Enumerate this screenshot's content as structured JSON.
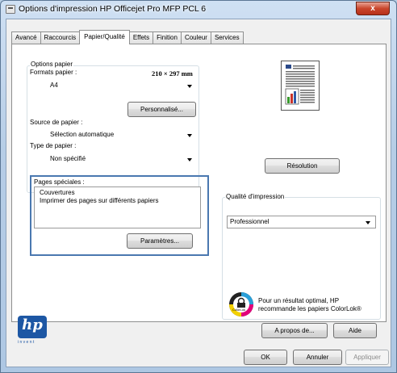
{
  "window": {
    "title": "Options d'impression HP Officejet Pro        MFP PCL 6",
    "close_label": "x"
  },
  "tabs": [
    {
      "label": "Avancé"
    },
    {
      "label": "Raccourcis"
    },
    {
      "label": "Papier/Qualité",
      "active": true
    },
    {
      "label": "Effets"
    },
    {
      "label": "Finition"
    },
    {
      "label": "Couleur"
    },
    {
      "label": "Services"
    }
  ],
  "paper_options": {
    "group_title": "Options papier",
    "size_label": "Formats papier :",
    "size_value": "210 × 297 mm",
    "size_selected": "A4",
    "custom_button": "Personnalisé...",
    "source_label": "Source de papier :",
    "source_selected": "Sélection automatique",
    "type_label": "Type de papier :",
    "type_selected": "Non spécifié"
  },
  "special_pages": {
    "label": "Pages spéciales :",
    "items": [
      "Couvertures",
      "Imprimer des pages sur différents papiers"
    ],
    "settings_button": "Paramètres..."
  },
  "resolution_button": "Résolution",
  "print_quality": {
    "group_title": "Qualité d'impression",
    "selected": "Professionnel"
  },
  "colorlok": {
    "badge": "ColorLok",
    "text_line1": "Pour un résultat optimal, HP",
    "text_line2": "recommande les papiers ColorLok®"
  },
  "logo": {
    "text": "hp",
    "tagline": "i n v e n t"
  },
  "footer": {
    "about_button": "A propos de...",
    "help_button": "Aide",
    "ok_button": "OK",
    "cancel_button": "Annuler",
    "apply_button": "Appliquer"
  },
  "colors": {
    "highlight_border": "#4a78b0",
    "hp_blue": "#1d57a4"
  }
}
